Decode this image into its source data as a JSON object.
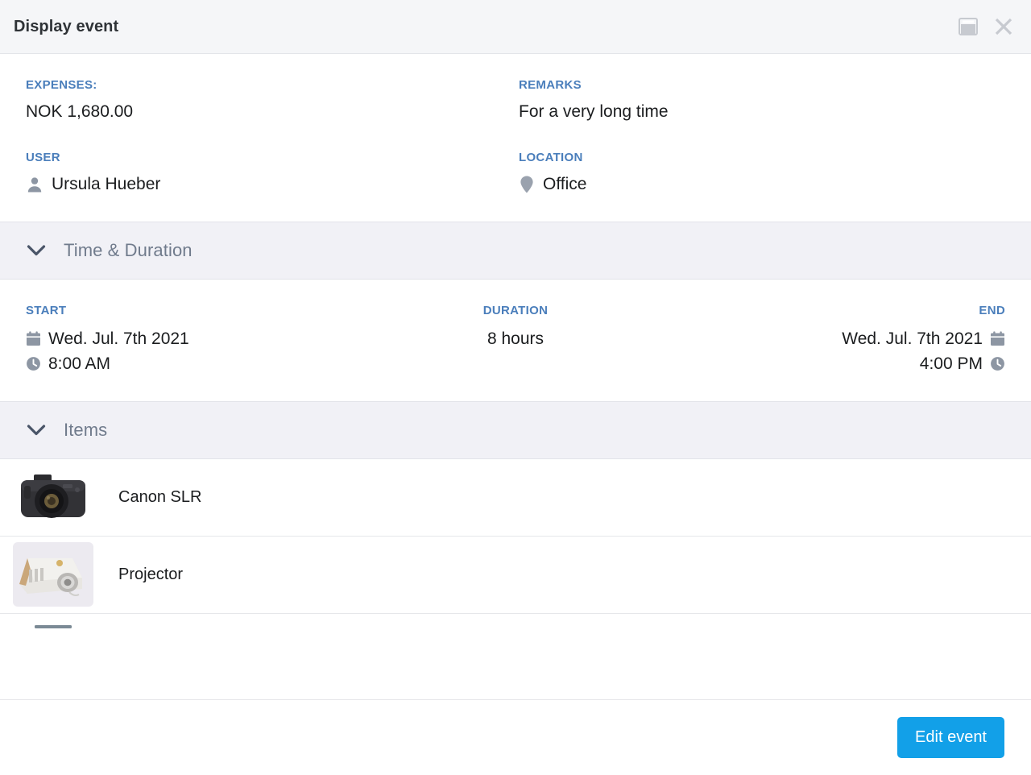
{
  "dialog": {
    "title": "Display event",
    "restore_icon": "restore-window-icon",
    "close_icon": "close-icon"
  },
  "details": {
    "expenses": {
      "label": "EXPENSES:",
      "value": "NOK 1,680.00"
    },
    "remarks": {
      "label": "REMARKS",
      "value": "For a very long time"
    },
    "user": {
      "label": "USER",
      "value": "Ursula Hueber",
      "icon": "person-icon"
    },
    "location": {
      "label": "LOCATION",
      "value": "Office",
      "icon": "map-pin-icon"
    }
  },
  "sections": [
    {
      "id": "time",
      "title": "Time & Duration",
      "chevron": "chevron-down-icon",
      "expanded": true
    },
    {
      "id": "items",
      "title": "Items",
      "chevron": "chevron-down-icon",
      "expanded": true
    }
  ],
  "time": {
    "start": {
      "label": "START",
      "date": "Wed. Jul. 7th 2021",
      "time": "8:00 AM",
      "date_icon": "calendar-icon",
      "time_icon": "clock-icon"
    },
    "duration": {
      "label": "DURATION",
      "value": "8 hours"
    },
    "end": {
      "label": "END",
      "date": "Wed. Jul. 7th 2021",
      "time": "4:00 PM",
      "date_icon": "calendar-icon",
      "time_icon": "clock-icon"
    }
  },
  "items": [
    {
      "name": "Canon SLR",
      "thumb": "dslr-camera-photo"
    },
    {
      "name": "Projector",
      "thumb": "projector-photo"
    },
    {
      "name": "",
      "thumb": "cut-off-item-photo"
    }
  ],
  "footer": {
    "primary_button": "Edit event"
  },
  "colors": {
    "accent_blue": "#12a0e8",
    "label_blue": "#4a7ebb",
    "section_title": "#707b8c",
    "section_band": "#f1f1f6",
    "header_band": "#f5f6f8",
    "text": "#1b1d1f"
  }
}
